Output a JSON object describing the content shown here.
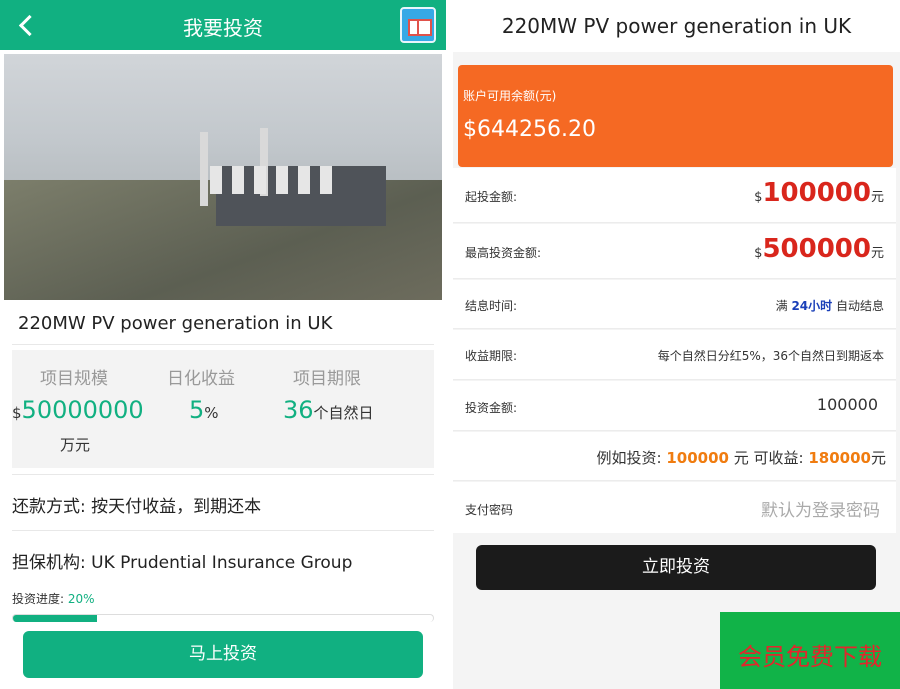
{
  "left": {
    "topbar": {
      "title": "我要投资",
      "back_icon": "chevron-left-icon",
      "right_icon": "book-icon"
    },
    "project_title": "220MW PV power generation in UK",
    "stats": {
      "scale_label": "项目规模",
      "scale_currency": "$",
      "scale_value": "50000000",
      "scale_unit": "万元",
      "yield_label": "日化收益",
      "yield_value": "5",
      "yield_unit": "%",
      "term_label": "项目期限",
      "term_value": "36",
      "term_unit": "个自然日"
    },
    "repayment": "还款方式:  按天付收益，到期还本",
    "guarantor": "担保机构:  UK Prudential Insurance Group",
    "progress": {
      "label": "投资进度:",
      "value_text": "20%",
      "value": 0.2
    },
    "invest_button": "马上投资"
  },
  "right": {
    "header": "220MW PV power generation in UK",
    "balance": {
      "label": "账户可用余额(元)",
      "amount": "$644256.20"
    },
    "rows": {
      "min_label": "起投金额:",
      "min_currency": "$",
      "min_value": "100000",
      "min_unit": "元",
      "max_label": "最高投资金额:",
      "max_currency": "$",
      "max_value": "500000",
      "max_unit": "元",
      "interest_label": "结息时间:",
      "interest_prefix": "满",
      "interest_value": "24小时",
      "interest_suffix": "自动结息",
      "period_label": "收益期限:",
      "period_value": "每个自然日分红5%，36个自然日到期返本",
      "amount_label": "投资金额:",
      "amount_value": "100000",
      "example_prefix": "例如投资:",
      "example_invest": "100000",
      "example_mid": "元 可收益:",
      "example_gain": "180000",
      "example_unit": "元",
      "password_label": "支付密码",
      "password_placeholder": "默认为登录密码"
    },
    "submit_button": "立即投资",
    "promo": "会员免费下载"
  },
  "colors": {
    "green": "#11b081",
    "orange": "#f56923",
    "red": "#d9261c",
    "dark": "#1b1b1b"
  }
}
